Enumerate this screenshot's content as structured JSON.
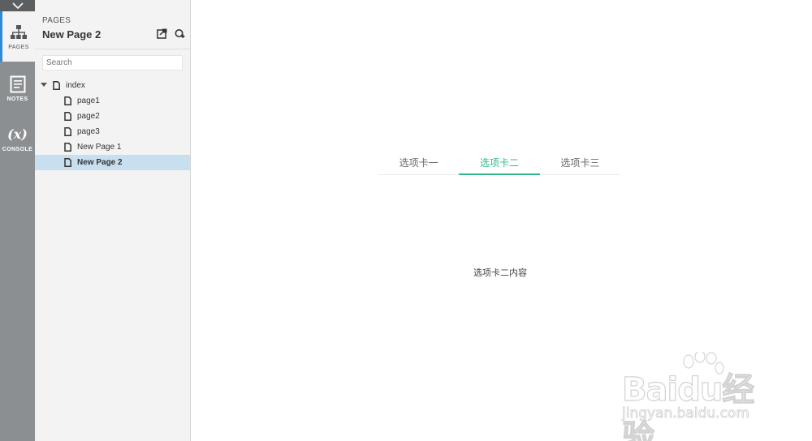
{
  "rail": {
    "pages_label": "PAGES",
    "notes_label": "NOTES",
    "console_label": "CONSOLE",
    "console_icon_text": "(x)"
  },
  "panel": {
    "caption": "PAGES",
    "title": "New Page 2",
    "search_placeholder": "Search",
    "tree": [
      {
        "label": "index",
        "level": 0
      },
      {
        "label": "page1",
        "level": 1
      },
      {
        "label": "page2",
        "level": 1
      },
      {
        "label": "page3",
        "level": 1
      },
      {
        "label": "New Page 1",
        "level": 1
      },
      {
        "label": "New Page 2",
        "level": 1,
        "selected": true
      }
    ]
  },
  "canvas": {
    "tabs": [
      "选项卡一",
      "选项卡二",
      "选项卡三"
    ],
    "active_tab": 1,
    "content": "选项卡二内容",
    "accent_color": "#2fb88b"
  },
  "watermark": {
    "logo_text": "Baidu经验",
    "url": "jingyan.baidu.com"
  }
}
